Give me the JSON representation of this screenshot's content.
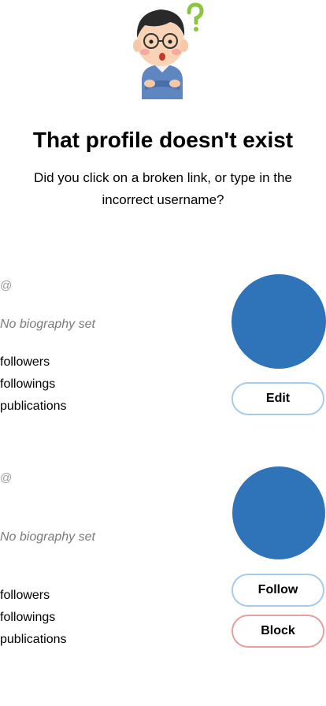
{
  "not_found": {
    "title": "That profile doesn't exist",
    "message": "Did you click on a broken link, or type in the incorrect username?",
    "illustration_icon": "confused-person-icon"
  },
  "profiles": [
    {
      "handle": "@",
      "bio": "No biography set",
      "followers_label": "followers",
      "followings_label": "followings",
      "publications_label": "publications",
      "avatar_color": "#2f74b9",
      "actions": [
        {
          "label": "Edit",
          "accent": "#a7cbea"
        }
      ]
    },
    {
      "handle": "@",
      "bio": "No biography set",
      "followers_label": "followers",
      "followings_label": "followings",
      "publications_label": "publications",
      "avatar_color": "#2f74b9",
      "actions": [
        {
          "label": "Follow",
          "accent": "#a7cbea"
        },
        {
          "label": "Block",
          "accent": "#e4a0a0"
        }
      ]
    }
  ]
}
